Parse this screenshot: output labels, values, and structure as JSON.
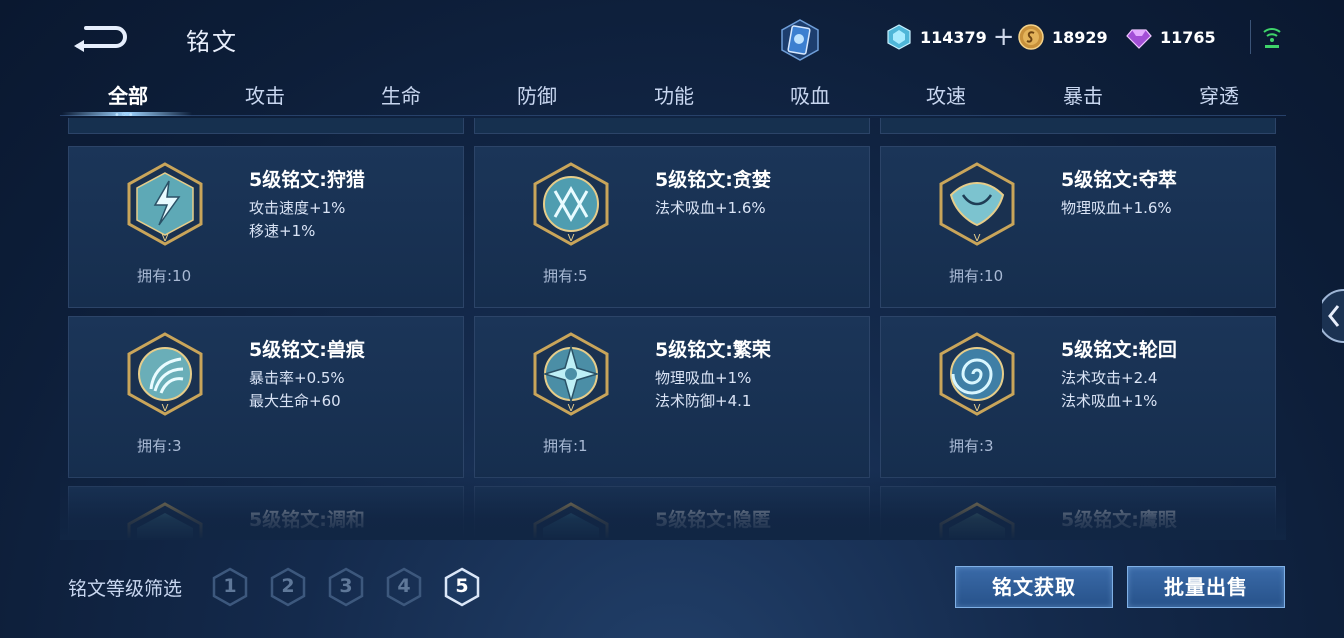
{
  "header": {
    "title": "铭文",
    "currencies": [
      {
        "name": "diamond",
        "value": "114379"
      },
      {
        "name": "gold",
        "value": "18929"
      },
      {
        "name": "gem",
        "value": "11765"
      }
    ],
    "plus_label": "+"
  },
  "tabs": [
    "全部",
    "攻击",
    "生命",
    "防御",
    "功能",
    "吸血",
    "攻速",
    "暴击",
    "穿透"
  ],
  "active_tab": 0,
  "runes": [
    {
      "name": "5级铭文:狩猎",
      "attrs": [
        "攻击速度+1%",
        "移速+1%"
      ],
      "own": "拥有:10",
      "icon": "lightning-rune-icon"
    },
    {
      "name": "5级铭文:贪婪",
      "attrs": [
        "法术吸血+1.6%"
      ],
      "own": "拥有:5",
      "icon": "greed-rune-icon"
    },
    {
      "name": "5级铭文:夺萃",
      "attrs": [
        "物理吸血+1.6%"
      ],
      "own": "拥有:10",
      "icon": "leaf-rune-icon"
    },
    {
      "name": "5级铭文:兽痕",
      "attrs": [
        "暴击率+0.5%",
        "最大生命+60"
      ],
      "own": "拥有:3",
      "icon": "claw-rune-icon"
    },
    {
      "name": "5级铭文:繁荣",
      "attrs": [
        "物理吸血+1%",
        "法术防御+4.1"
      ],
      "own": "拥有:1",
      "icon": "star-rune-icon"
    },
    {
      "name": "5级铭文:轮回",
      "attrs": [
        "法术攻击+2.4",
        "法术吸血+1%"
      ],
      "own": "拥有:3",
      "icon": "spiral-rune-icon"
    },
    {
      "name": "5级铭文:调和",
      "attrs": [],
      "own": "",
      "icon": "harmony-rune-icon"
    },
    {
      "name": "5级铭文:隐匿",
      "attrs": [],
      "own": "",
      "icon": "hidden-rune-icon"
    },
    {
      "name": "5级铭文:鹰眼",
      "attrs": [],
      "own": "",
      "icon": "eagle-rune-icon"
    }
  ],
  "rune_level_mark": "V",
  "filter": {
    "label": "铭文等级筛选",
    "levels": [
      "1",
      "2",
      "3",
      "4",
      "5"
    ],
    "selected": "5"
  },
  "actions": {
    "get_label": "铭文获取",
    "sell_label": "批量出售"
  },
  "colors": {
    "accent": "#9fd4ff",
    "gold": "#c9a55a",
    "button": "#2f5f9c"
  }
}
